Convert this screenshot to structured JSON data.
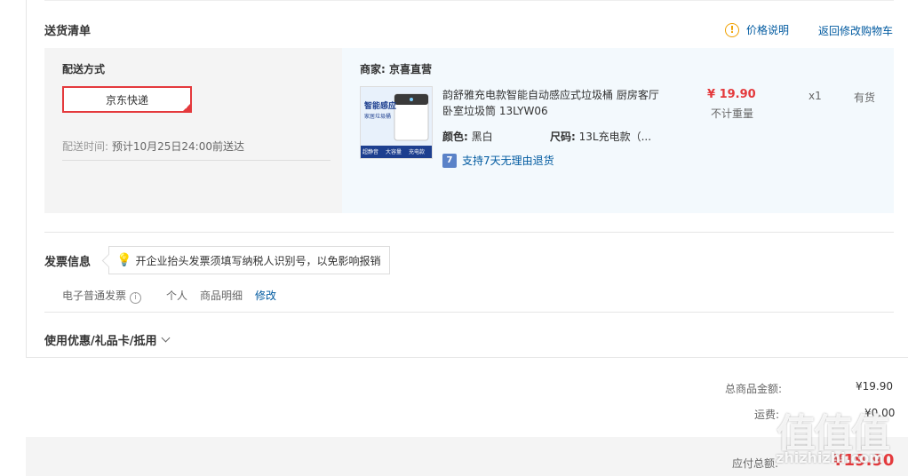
{
  "header": {
    "title": "送货清单",
    "price_note": "价格说明",
    "return_cart": "返回修改购物车"
  },
  "delivery": {
    "method_label": "配送方式",
    "method": "京东快递",
    "time_label": "配送时间:",
    "time_value": "预计10月25日24:00前送达"
  },
  "merchant": {
    "label": "商家:",
    "name": "京喜直营"
  },
  "product": {
    "name": "韵舒雅充电款智能自动感应式垃圾桶 厨房客厅卧室垃圾筒 13LYW06",
    "color_label": "颜色:",
    "color_value": "黑白",
    "size_label": "尺码:",
    "size_value": "13L充电款（...",
    "return_policy": "支持7天无理由退货",
    "return_icon": "7",
    "price": "¥ 19.90",
    "weight": "不计重量",
    "qty": "x1",
    "stock": "有货",
    "image_text_top": "智能感应",
    "image_text_sub": "家居垃圾桶",
    "image_badges": [
      "超静音",
      "大容量",
      "充电款"
    ]
  },
  "invoice": {
    "title": "发票信息",
    "tip": "开企业抬头发票须填写纳税人识别号，以免影响报销",
    "type": "电子普通发票",
    "holder": "个人",
    "content": "商品明细",
    "edit": "修改"
  },
  "coupon": {
    "label": "使用优惠/礼品卡/抵用"
  },
  "summary": {
    "goods_label": "总商品金额:",
    "goods_value": "¥19.90",
    "shipping_label": "运费:",
    "shipping_value": "¥0.00",
    "total_label": "应付总额:",
    "total_value": "¥19.90"
  },
  "watermark": {
    "text": "值值值",
    "url": "zhizhizhi.com"
  },
  "colors": {
    "accent_red": "#e4393c",
    "link_blue": "#005aa0",
    "warn_orange": "#f0a000"
  }
}
